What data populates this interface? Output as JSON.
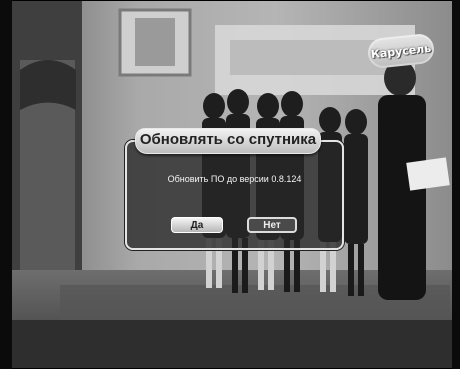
{
  "overlay": {
    "channel_logo_text": "Карусель",
    "dialog": {
      "title": "Обновлять со спутника",
      "message": "Обновить ПО до версии 0.8.124",
      "yes_label": "Да",
      "no_label": "Нет"
    }
  },
  "colors": {
    "dialog_border": "#e4e4e4",
    "dialog_bg": "#282828",
    "title_tab": "#d9d9d9",
    "message_text": "#f4f4f4"
  }
}
